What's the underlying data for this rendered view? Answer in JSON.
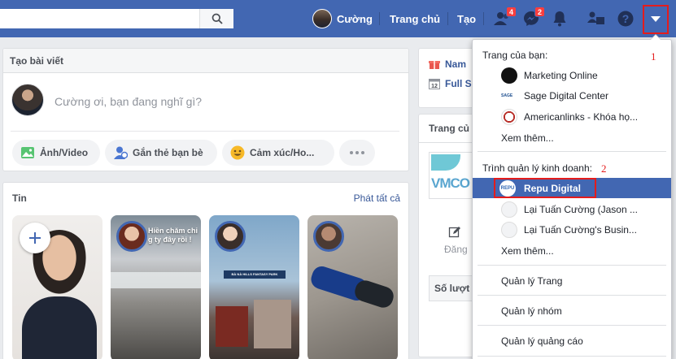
{
  "header": {
    "search_value": "",
    "user_name": "Cường",
    "home_label": "Trang chủ",
    "create_label": "Tạo",
    "friend_requests_count": "4",
    "messages_count": "2"
  },
  "composer": {
    "title": "Tạo bài viết",
    "prompt": "Cường ơi, bạn đang nghĩ gì?",
    "actions": [
      "Ảnh/Video",
      "Gắn thẻ bạn bè",
      "Cảm xúc/Ho..."
    ]
  },
  "stories": {
    "title": "Tin",
    "see_all": "Phát tất cả",
    "story2_caption_line1": "Hiền chăm chỉ",
    "story2_caption_line2": "g ty đây rồi !",
    "story3_sign": "BÀ NÀ HILLS FANTASY PARK"
  },
  "right_column": {
    "row1": "Nam",
    "row2": "Full S",
    "row2_icon_text": "12",
    "pages_title": "Trang củ",
    "vmc_logo": "VMCO",
    "post_label": "Đăng",
    "stats_label": "Số lượt"
  },
  "menu": {
    "your_pages_title": "Trang của bạn:",
    "annotation_1": "1",
    "pages": [
      "Marketing Online",
      "Sage Digital Center",
      "Americanlinks - Khóa họ..."
    ],
    "see_more_1": "Xem thêm...",
    "business_title": "Trình quản lý kinh doanh:",
    "annotation_2": "2",
    "businesses": [
      "Repu Digital",
      "Lại Tuấn Cường (Jason ...",
      "Lại Tuấn Cường's Busin..."
    ],
    "repu_logo_text": "REPU",
    "see_more_2": "Xem thêm...",
    "manage_pages": "Quản lý Trang",
    "manage_groups": "Quản lý nhóm",
    "manage_ads": "Quản lý quảng cáo"
  },
  "colors": {
    "brand_blue": "#4267b2",
    "badge_red": "#fa3e3e",
    "annotation_red": "#e41c1c"
  }
}
